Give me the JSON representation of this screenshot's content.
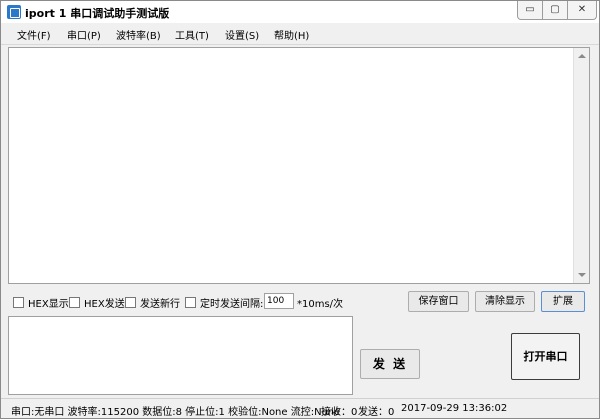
{
  "window": {
    "title": "iport 1 串口调试助手测试版",
    "controls": {
      "minimize": "▭",
      "maximize": "▢",
      "close": "✕"
    }
  },
  "menu": {
    "items": [
      {
        "label": "文件(F)"
      },
      {
        "label": "串口(P)"
      },
      {
        "label": "波特率(B)"
      },
      {
        "label": "工具(T)"
      },
      {
        "label": "设置(S)"
      },
      {
        "label": "帮助(H)"
      }
    ]
  },
  "options": {
    "hex_display": "HEX显示",
    "hex_send": "HEX发送",
    "send_newline": "发送新行",
    "timed_send": "定时发送",
    "interval_label": "间隔:",
    "interval_value": "100",
    "interval_unit": "*10ms/次"
  },
  "buttons": {
    "save_window": "保存窗口",
    "clear_display": "清除显示",
    "expand": "扩展",
    "send": "发 送",
    "open_port": "打开串口"
  },
  "status": {
    "port_info": "串口:无串口 波特率:115200 数据位:8 停止位:1 校验位:None 流控:None",
    "receive": "接收：0",
    "sent": "发送：0",
    "time": "2017-09-29 13:36:02"
  },
  "colors": {
    "icon": "#2b79c9",
    "expand_border": "#5b8ed6"
  }
}
